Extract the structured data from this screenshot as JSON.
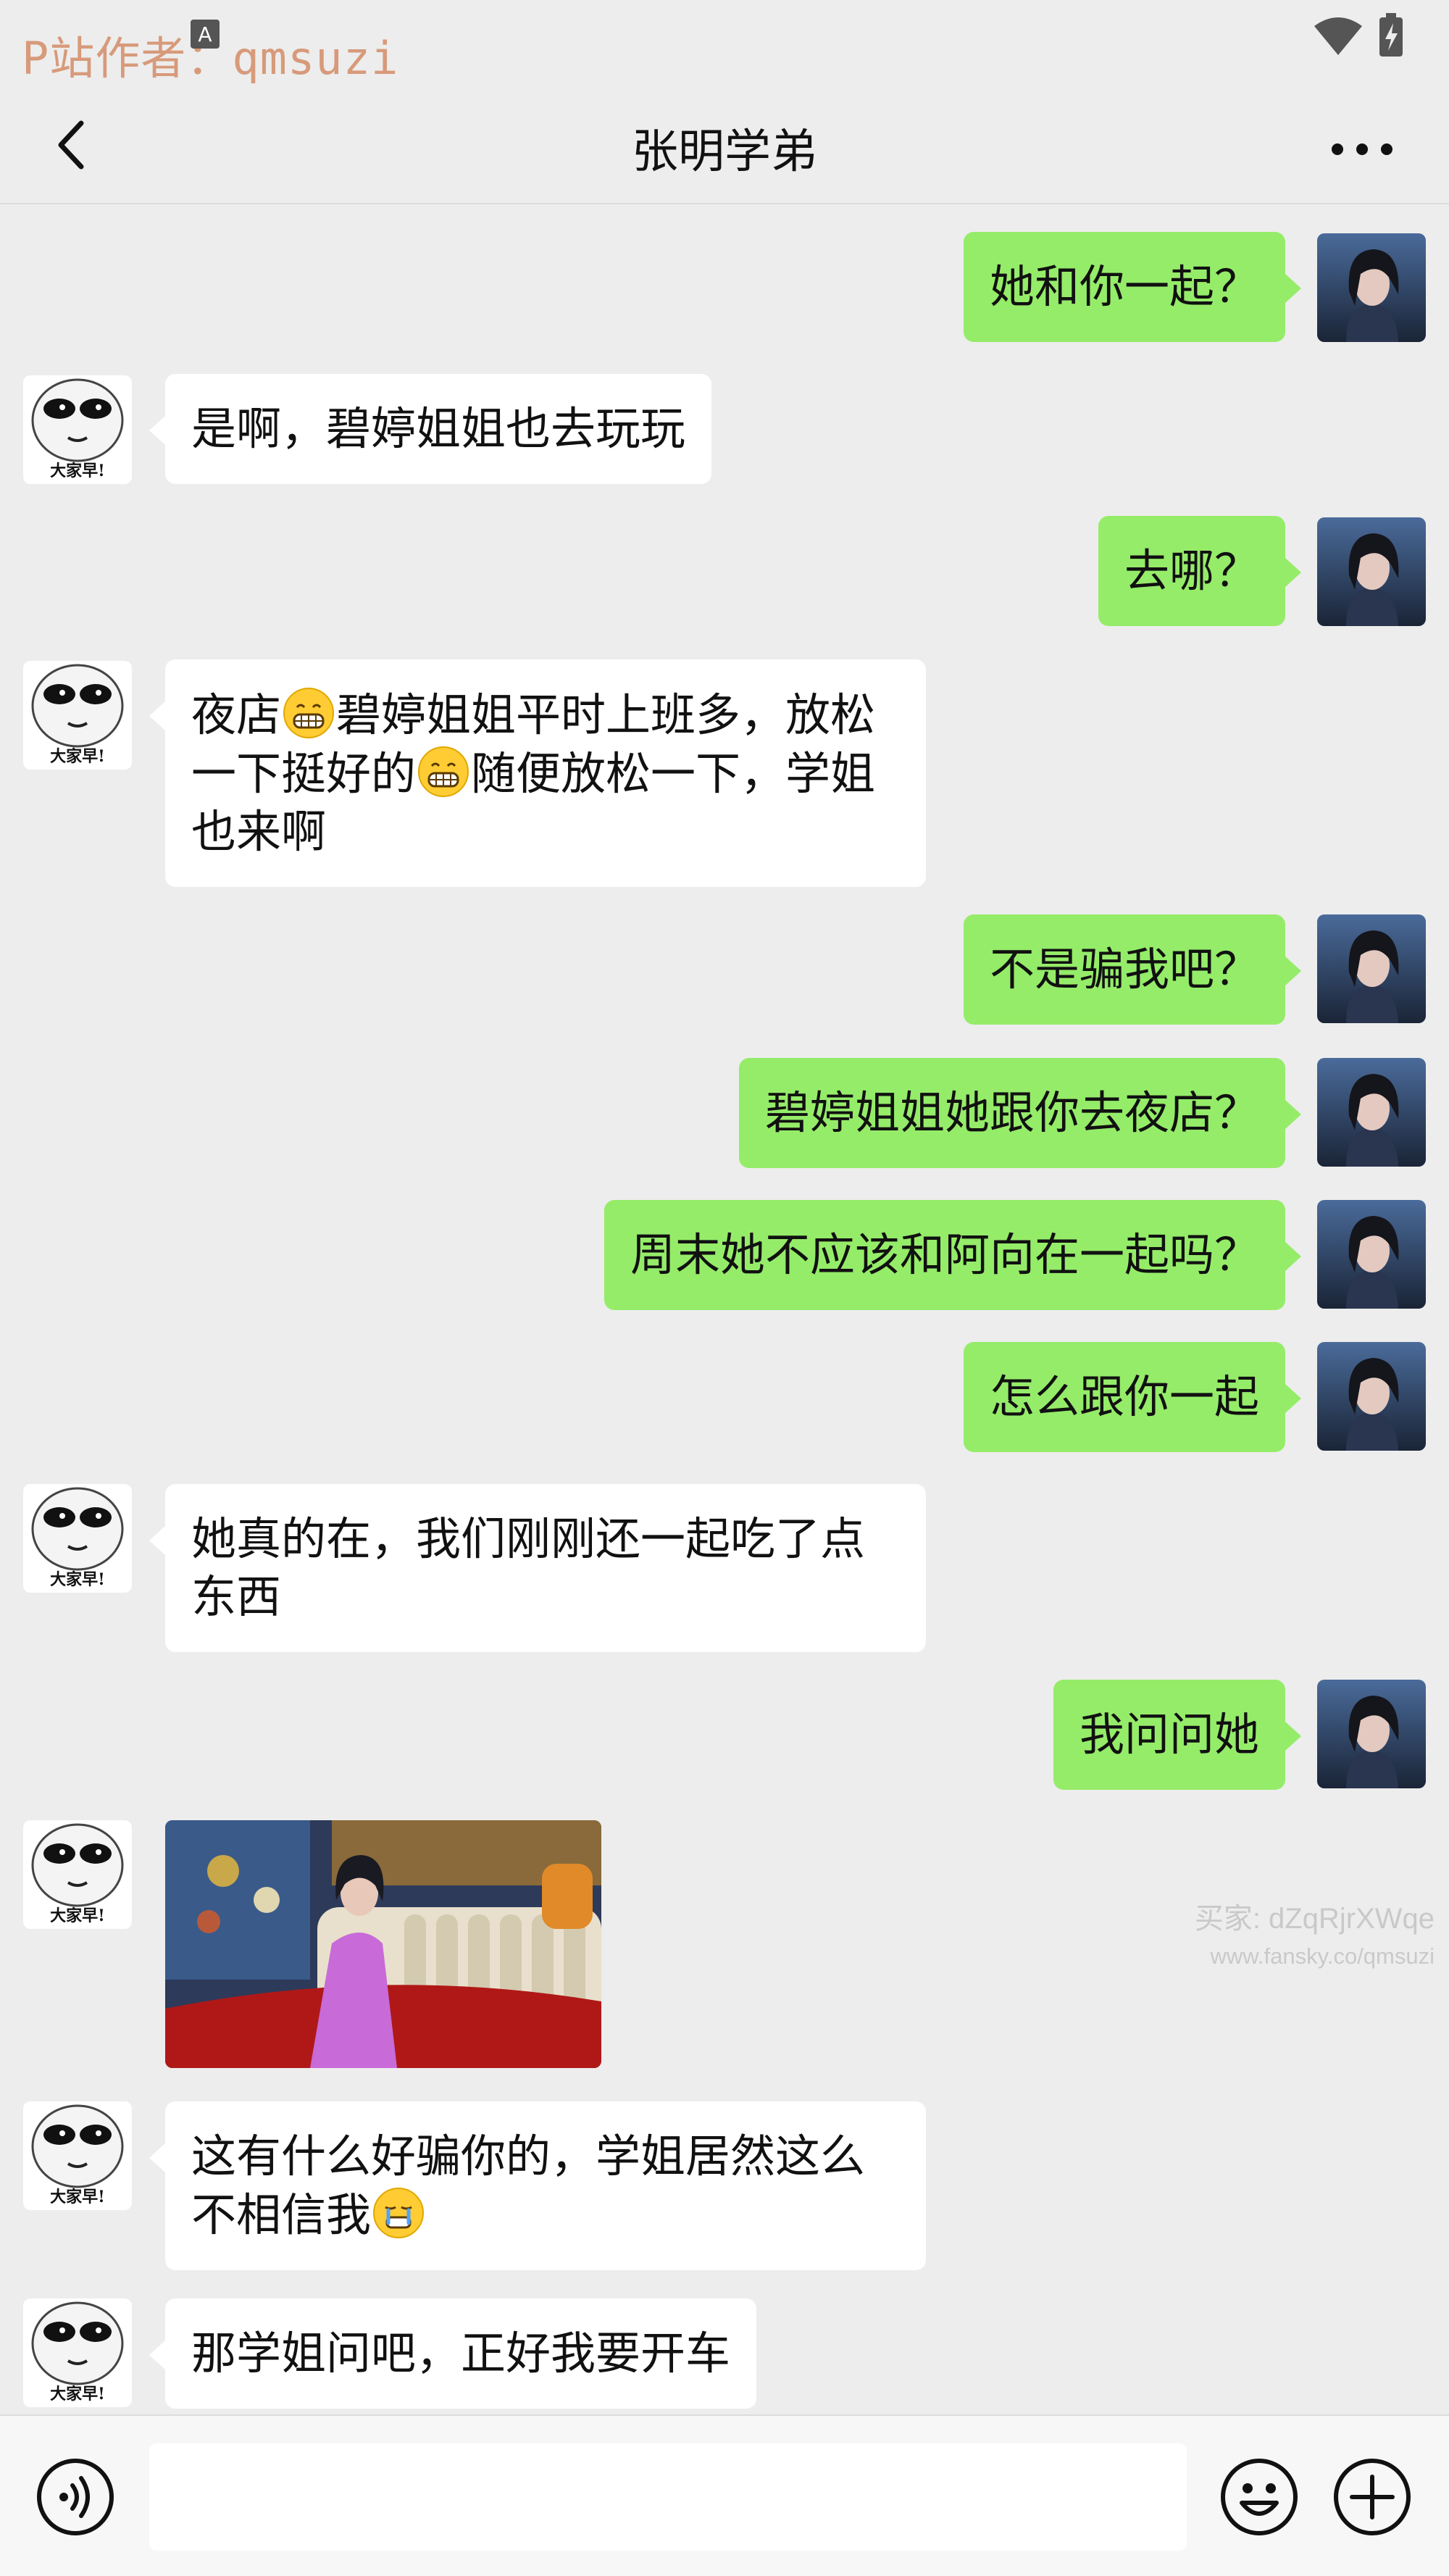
{
  "status_bar": {
    "watermark": "P站作者：qmsuzi"
  },
  "header": {
    "title": "张明学弟",
    "back_icon": "chevron-left-icon",
    "more_icon": "more-dots-icon"
  },
  "messages": [
    {
      "side": "right",
      "text": "她和你一起？"
    },
    {
      "side": "left",
      "text": "是啊，碧婷姐姐也去玩玩"
    },
    {
      "side": "right",
      "text": "去哪？"
    },
    {
      "side": "left",
      "segments": [
        {
          "text": "夜店"
        },
        {
          "emoji": "grin-emoji"
        },
        {
          "text": "碧婷姐姐平时上班多，放松一下挺好的"
        },
        {
          "emoji": "grin-emoji"
        },
        {
          "text": "随便放松一下，学姐也来啊"
        }
      ]
    },
    {
      "side": "right",
      "text": "不是骗我吧？"
    },
    {
      "side": "right",
      "text": "碧婷姐姐她跟你去夜店？"
    },
    {
      "side": "right",
      "text": "周末她不应该和阿向在一起吗？"
    },
    {
      "side": "right",
      "text": "怎么跟你一起"
    },
    {
      "side": "left",
      "text": "她真的在，我们刚刚还一起吃了点东西"
    },
    {
      "side": "right",
      "text": "我问问她"
    },
    {
      "side": "left",
      "type": "image"
    },
    {
      "side": "left",
      "segments": [
        {
          "text": "这有什么好骗你的，学姐居然这么不相信我"
        },
        {
          "emoji": "cry-emoji"
        }
      ]
    },
    {
      "side": "left",
      "text": "那学姐问吧，正好我要开车"
    }
  ],
  "avatar_left_caption": "大家早!",
  "watermark_right": {
    "line1": "买家: dZqRjrXWqe",
    "line2": "www.fansky.co/qmsuzi"
  },
  "input_bar": {
    "voice_icon": "voice-icon",
    "placeholder": "",
    "emoji_icon": "smiley-icon",
    "plus_icon": "plus-circle-icon"
  },
  "colors": {
    "background": "#ededed",
    "sent_bubble": "#95ec69",
    "received_bubble": "#ffffff"
  }
}
